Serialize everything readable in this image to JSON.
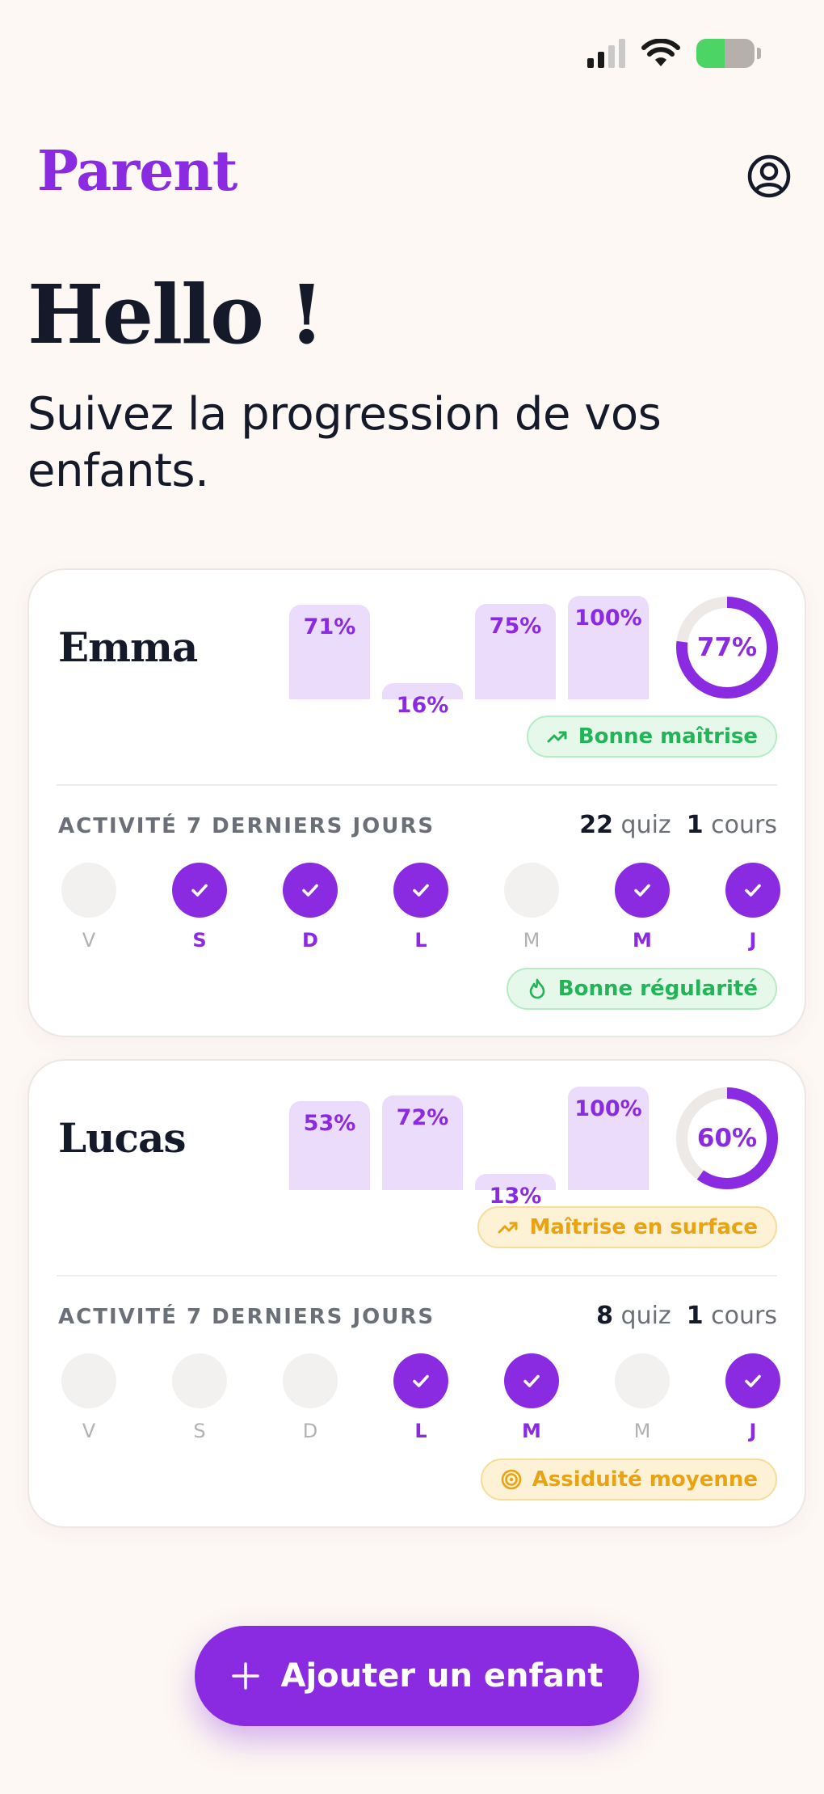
{
  "app": {
    "title": "Parent"
  },
  "greeting": {
    "title": "Hello !",
    "subtitle": "Suivez la progression de vos enfants."
  },
  "colors": {
    "accent": "#8a2be2",
    "good": "#23b457",
    "warning": "#e9a212"
  },
  "children": [
    {
      "name": "Emma",
      "bars": [
        {
          "label": "71%",
          "value": 71
        },
        {
          "label": "16%",
          "value": 16
        },
        {
          "label": "75%",
          "value": 75
        },
        {
          "label": "100%",
          "value": 100
        }
      ],
      "overall": {
        "label": "77%",
        "value": 77
      },
      "mastery_badge": {
        "label": "Bonne maîtrise",
        "tone": "green",
        "icon": "trend-up-icon"
      },
      "activity_label": "ACTIVITÉ 7 DERNIERS JOURS",
      "quiz_count": "22",
      "quiz_label": "quiz",
      "course_count": "1",
      "course_label": "cours",
      "days": [
        {
          "letter": "V",
          "active": false
        },
        {
          "letter": "S",
          "active": true
        },
        {
          "letter": "D",
          "active": true
        },
        {
          "letter": "L",
          "active": true
        },
        {
          "letter": "M",
          "active": false
        },
        {
          "letter": "M",
          "active": true
        },
        {
          "letter": "J",
          "active": true
        }
      ],
      "regularity_badge": {
        "label": "Bonne régularité",
        "tone": "green",
        "icon": "flame-icon"
      }
    },
    {
      "name": "Lucas",
      "bars": [
        {
          "label": "53%",
          "value": 53
        },
        {
          "label": "72%",
          "value": 72
        },
        {
          "label": "13%",
          "value": 13
        },
        {
          "label": "100%",
          "value": 100
        }
      ],
      "overall": {
        "label": "60%",
        "value": 60
      },
      "mastery_badge": {
        "label": "Maîtrise en surface",
        "tone": "orange",
        "icon": "trend-up-icon"
      },
      "activity_label": "ACTIVITÉ 7 DERNIERS JOURS",
      "quiz_count": "8",
      "quiz_label": "quiz",
      "course_count": "1",
      "course_label": "cours",
      "days": [
        {
          "letter": "V",
          "active": false
        },
        {
          "letter": "S",
          "active": false
        },
        {
          "letter": "D",
          "active": false
        },
        {
          "letter": "L",
          "active": true
        },
        {
          "letter": "M",
          "active": true
        },
        {
          "letter": "M",
          "active": false
        },
        {
          "letter": "J",
          "active": true
        }
      ],
      "regularity_badge": {
        "label": "Assiduité moyenne",
        "tone": "orange",
        "icon": "target-icon"
      }
    }
  ],
  "add_button": {
    "label": "Ajouter un enfant",
    "icon": "plus-icon"
  }
}
